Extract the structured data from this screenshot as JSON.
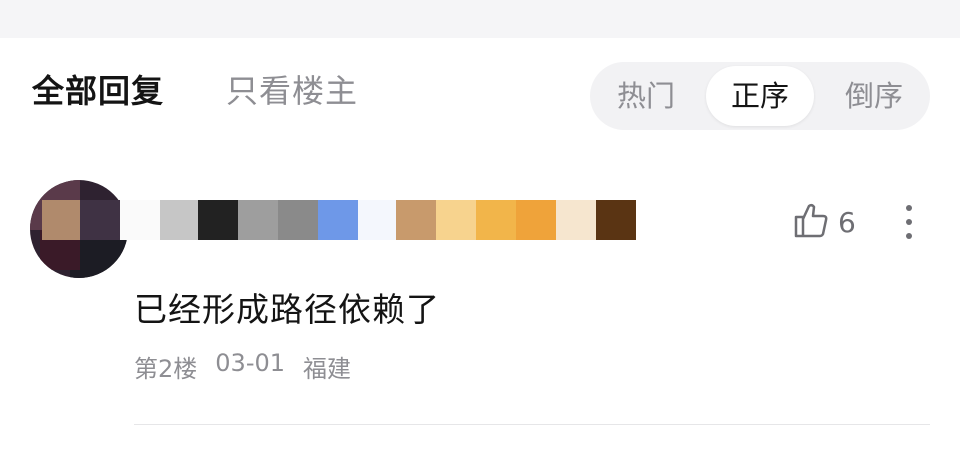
{
  "tabs": {
    "all_replies": "全部回复",
    "only_op": "只看楼主"
  },
  "sort": {
    "hot": "热门",
    "ascending": "正序",
    "descending": "倒序",
    "selected": "正序"
  },
  "comment": {
    "username": "",
    "avatar": "user-avatar",
    "text": "已经形成路径依赖了",
    "floor": "第2楼",
    "date": "03-01",
    "location": "福建",
    "like_count": "6"
  },
  "icons": {
    "like": "thumbs-up-icon",
    "more": "more-vertical-icon"
  },
  "colors": {
    "primary_text": "#141414",
    "secondary_text": "#8e8e93",
    "segment_bg": "#f2f2f4"
  }
}
